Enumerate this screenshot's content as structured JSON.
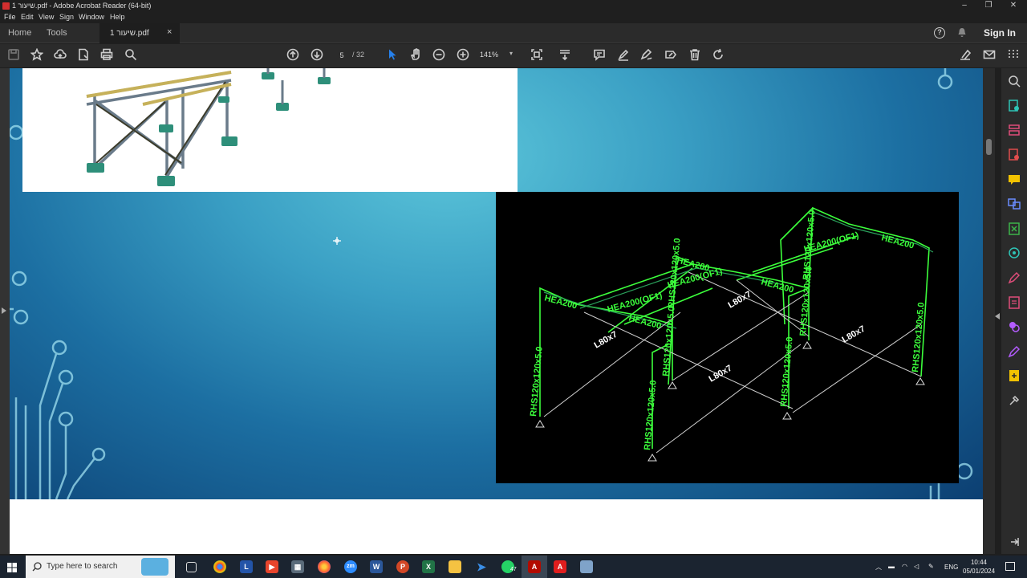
{
  "window": {
    "title": "שיעור 1.pdf - Adobe Acrobat Reader (64-bit)",
    "controls": [
      "–",
      "❐",
      "✕"
    ]
  },
  "menu": [
    "File",
    "Edit",
    "View",
    "Sign",
    "Window",
    "Help"
  ],
  "tabs": {
    "home": "Home",
    "tools": "Tools",
    "document": "שיעור 1.pdf",
    "close": "×"
  },
  "header": {
    "help": "?",
    "sign_in": "Sign In"
  },
  "toolbar": {
    "page_current": "5",
    "page_total": "/ 32",
    "zoom": "141%",
    "zoom_arrow": "▾"
  },
  "drawing": {
    "labels_green": [
      "HEA200",
      "HEA200(OF1)",
      "HEA200(OF1)",
      "HEA200(OF1)",
      "HEA200",
      "HEA200",
      "HEA200",
      "HEA200",
      "RHS120x120x5.0",
      "RHS120x120x5.0",
      "RHS120x120x5.0",
      "RHS120x120x5.0",
      "RHS120x120x5.0",
      "RHS120x120x5.0",
      "RHS120x120x5.0",
      "RHS120x120x5.0"
    ],
    "labels_white": [
      "L80x7",
      "L80x7",
      "L80x7",
      "L80x7"
    ]
  },
  "taskbar": {
    "search_placeholder": "Type here to search",
    "badge": "47",
    "language": "ENG",
    "time": "10:44",
    "date": "05/01/2024"
  },
  "colors": {
    "accent": "#2680eb",
    "acrobat_red": "#d32f2f",
    "green_label": "#3cff3c",
    "slide_light": "#5cc6da",
    "slide_dark": "#0c3f72"
  }
}
